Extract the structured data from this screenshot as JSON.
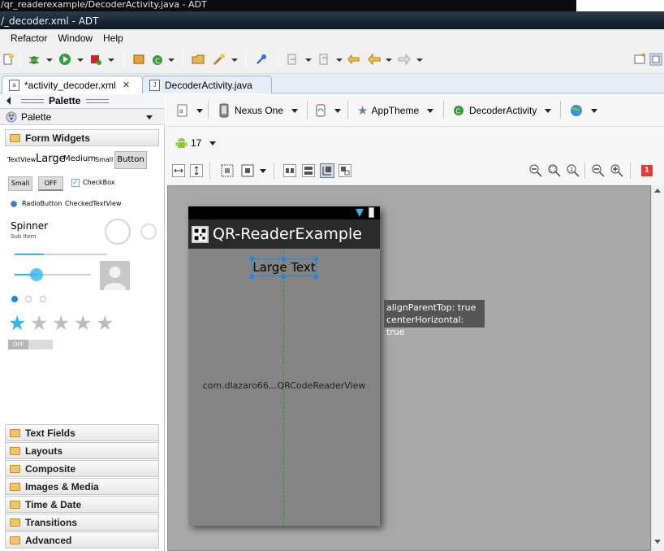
{
  "window": {
    "back_title": "/qr_readerexample/DecoderActivity.java - ADT",
    "front_title": "/_decoder.xml - ADT"
  },
  "menu": [
    "Refactor",
    "Window",
    "Help"
  ],
  "tabs": [
    {
      "label": "*activity_decoder.xml",
      "active": true,
      "closable": true
    },
    {
      "label": "DecoderActivity.java",
      "active": false,
      "closable": false
    }
  ],
  "palette": {
    "header": "Palette",
    "dropdown_label": "Palette",
    "open_category": "Form Widgets",
    "widgets": {
      "textview": "TextView",
      "large": "Large",
      "medium": "Medium",
      "small": "Small",
      "button": "Button",
      "small_button": "Small",
      "toggle_off": "OFF",
      "checkbox": "CheckBox",
      "radiobutton": "RadioButton",
      "checked_textview": "CheckedTextView",
      "spinner": "Spinner",
      "spinner_sub": "Sub Item",
      "switch_off": "OFF"
    },
    "categories": [
      "Text Fields",
      "Layouts",
      "Composite",
      "Images & Media",
      "Time & Date",
      "Transitions",
      "Advanced"
    ]
  },
  "editor": {
    "device": "Nexus One",
    "theme": "AppTheme",
    "activity": "DecoderActivity",
    "api_level": "17",
    "error_count": "1"
  },
  "phone": {
    "app_title": "QR-ReaderExample",
    "large_text": "Large Text",
    "custom_view": "com.dlazaro66...QRCodeReaderView"
  },
  "tooltip": {
    "line1": "alignParentTop: true",
    "line2": "centerHorizontal: true"
  },
  "colors": {
    "accent": "#1e88e5",
    "guide": "#1aa51a",
    "canvas": "#a8a8a8",
    "phone_bg": "#848484"
  }
}
